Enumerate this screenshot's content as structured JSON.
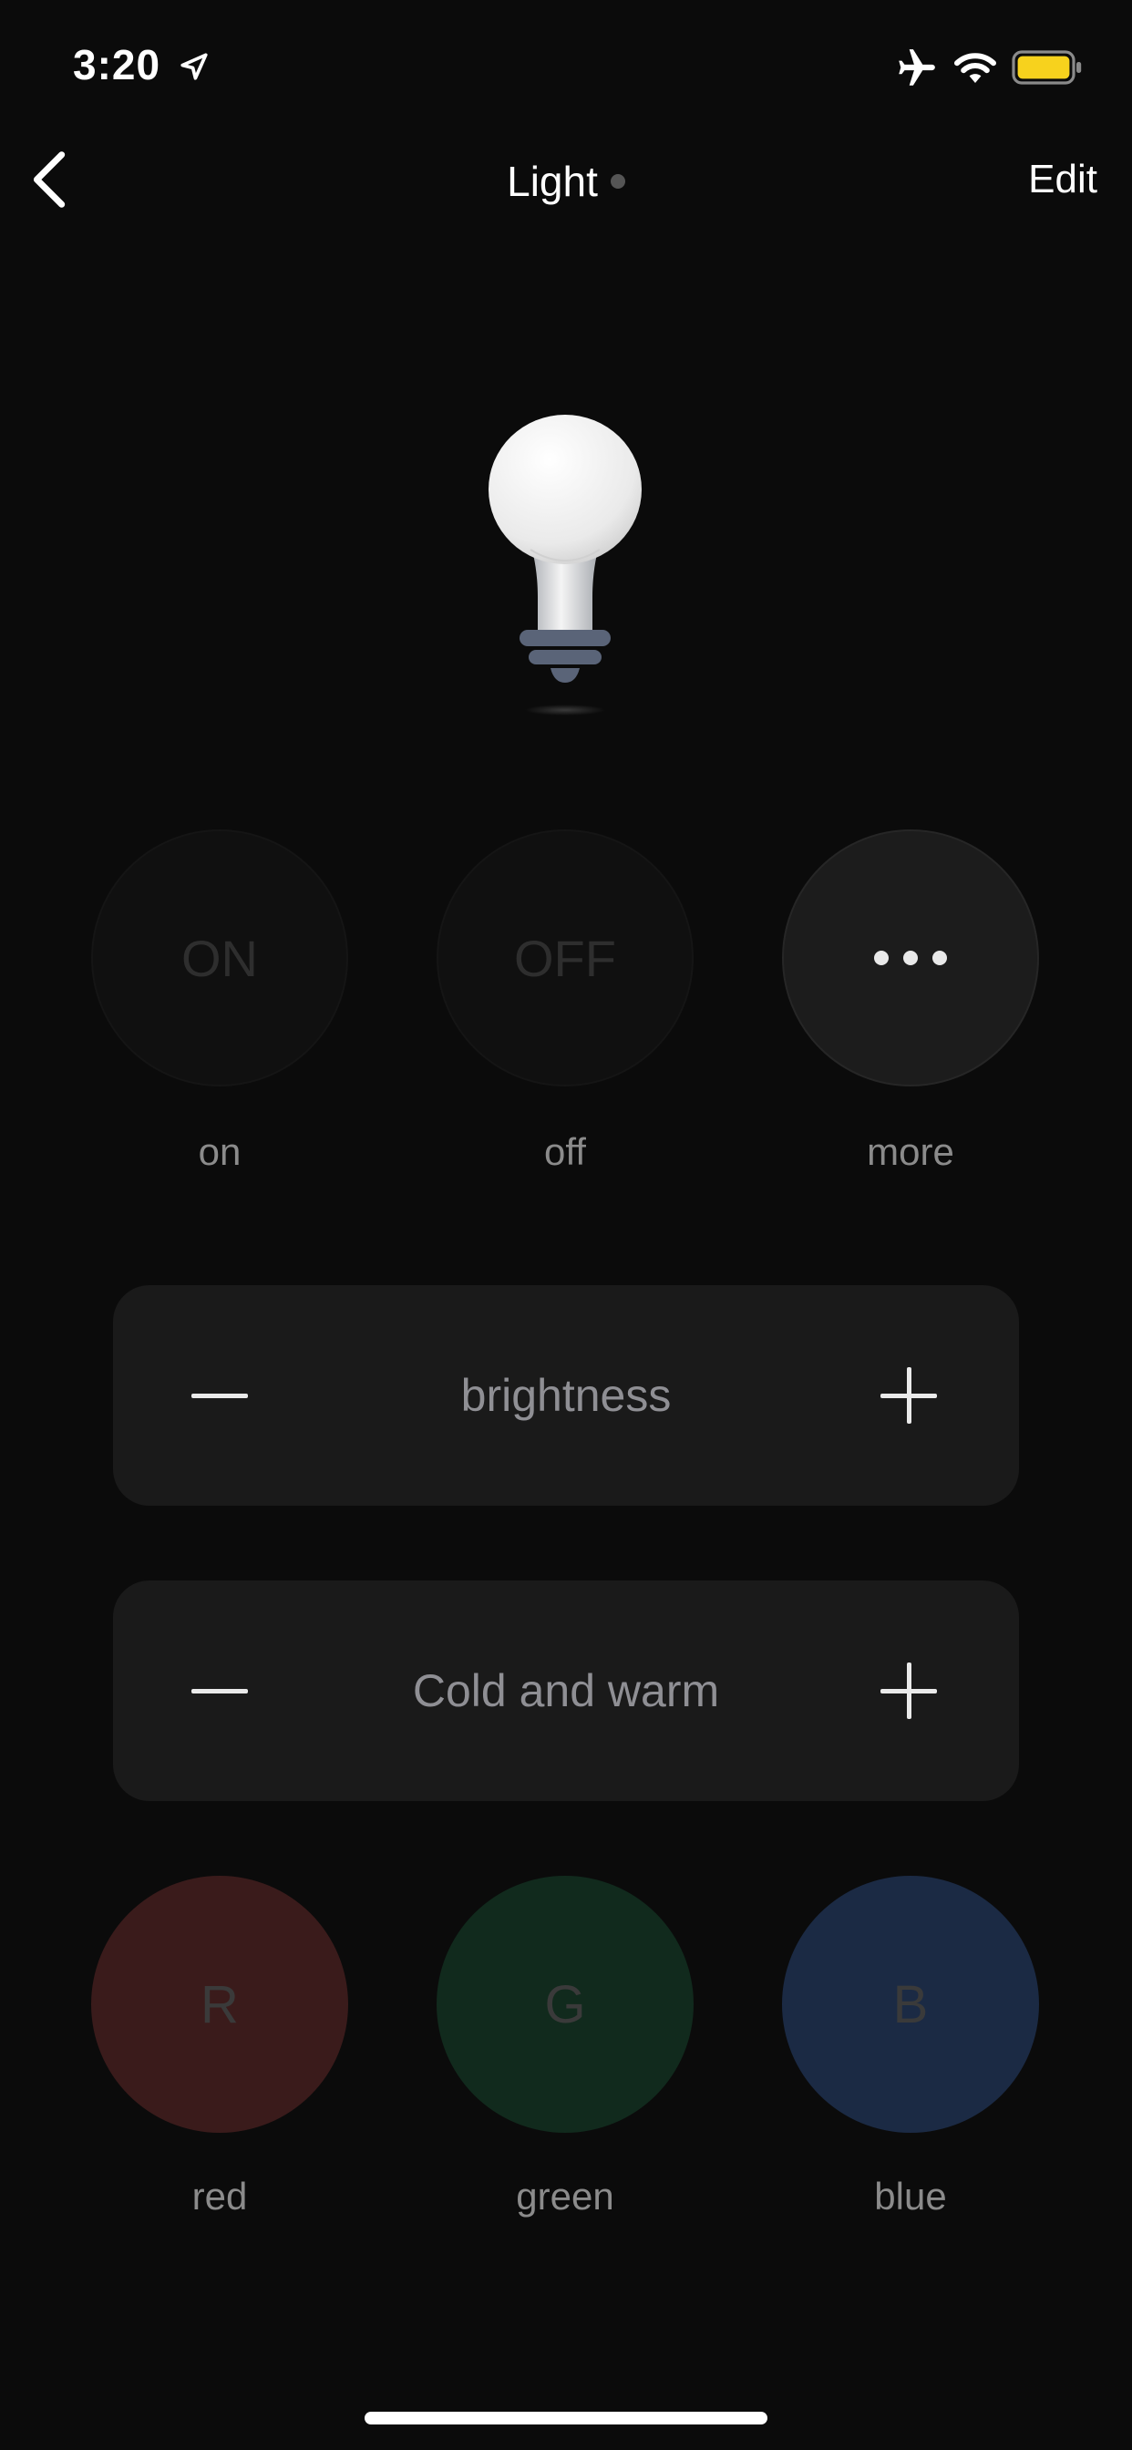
{
  "status_bar": {
    "time": "3:20",
    "icons": [
      "location-arrow-icon",
      "airplane-icon",
      "wifi-icon",
      "battery-icon"
    ],
    "battery_color": "#f7d21d"
  },
  "nav": {
    "back_icon": "chevron-left-icon",
    "title": "Light",
    "status_dot_color": "#555555",
    "edit_label": "Edit"
  },
  "device": {
    "icon": "light-bulb-icon"
  },
  "controls": {
    "on": {
      "label": "ON",
      "caption": "on"
    },
    "off": {
      "label": "OFF",
      "caption": "off"
    },
    "more": {
      "icon": "more-dots-icon",
      "caption": "more"
    }
  },
  "panels": {
    "brightness": {
      "label": "brightness",
      "minus_icon": "minus-icon",
      "plus_icon": "plus-icon"
    },
    "color_temp": {
      "label": "Cold and warm",
      "minus_icon": "minus-icon",
      "plus_icon": "plus-icon"
    }
  },
  "colors": {
    "red": {
      "label": "R",
      "caption": "red",
      "bg": "#3a1b1b"
    },
    "green": {
      "label": "G",
      "caption": "green",
      "bg": "#112a1d"
    },
    "blue": {
      "label": "B",
      "caption": "blue",
      "bg": "#1b2a44"
    }
  }
}
